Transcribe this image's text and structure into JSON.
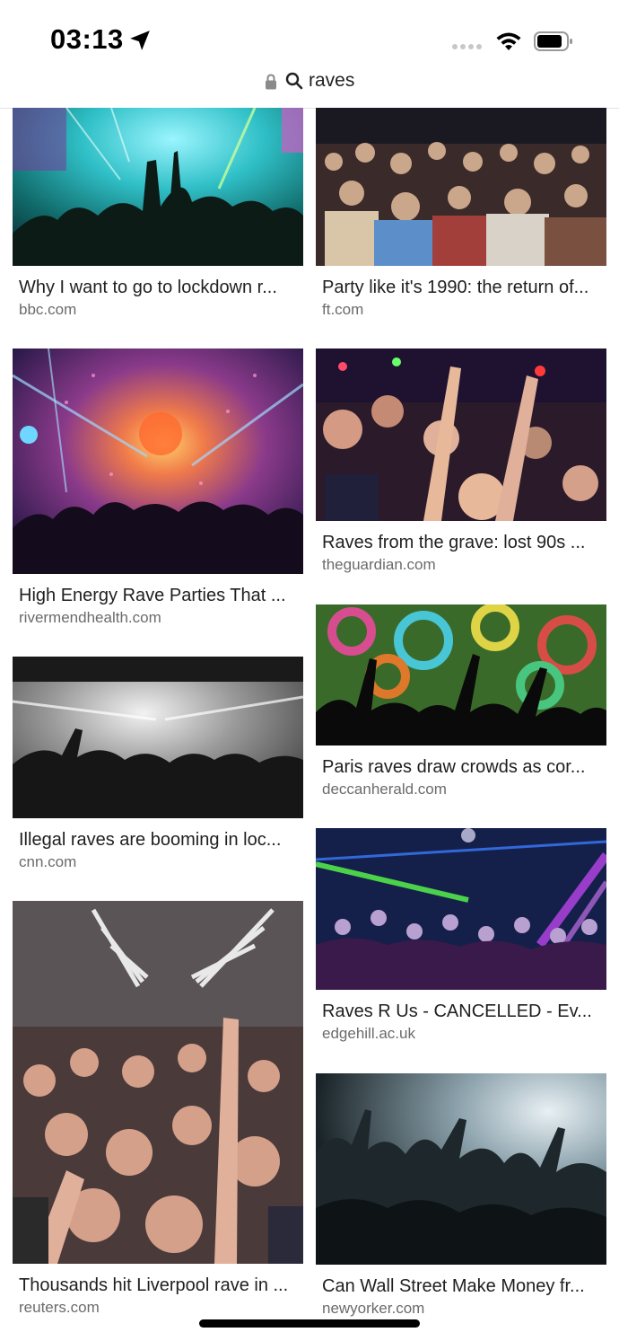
{
  "status_bar": {
    "time": "03:13",
    "icons": [
      "location-arrow-icon",
      "cellular-signal-icon",
      "wifi-icon",
      "battery-icon"
    ]
  },
  "url_bar": {
    "icons": [
      "lock-icon",
      "search-icon"
    ],
    "query": "raves"
  },
  "results": [
    {
      "title": "Why I want to go to lockdown r...",
      "domain": "bbc.com"
    },
    {
      "title": "Party like it's 1990: the return of...",
      "domain": "ft.com"
    },
    {
      "title": "High Energy Rave Parties That ...",
      "domain": "rivermendhealth.com"
    },
    {
      "title": "Raves from the grave: lost 90s ...",
      "domain": "theguardian.com"
    },
    {
      "title": "Illegal raves are booming in loc...",
      "domain": "cnn.com"
    },
    {
      "title": "Paris raves draw crowds as cor...",
      "domain": "deccanherald.com"
    },
    {
      "title": "Thousands hit Liverpool rave in ...",
      "domain": "reuters.com"
    },
    {
      "title": "Raves R Us - CANCELLED - Ev...",
      "domain": "edgehill.ac.uk"
    },
    {
      "title": "Can Wall Street Make Money fr...",
      "domain": "newyorker.com"
    }
  ]
}
